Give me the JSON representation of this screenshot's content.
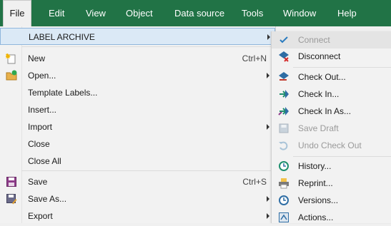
{
  "menubar": {
    "items": [
      {
        "label": "File"
      },
      {
        "label": "Edit"
      },
      {
        "label": "View"
      },
      {
        "label": "Object"
      },
      {
        "label": "Data source"
      },
      {
        "label": "Tools"
      },
      {
        "label": "Window"
      },
      {
        "label": "Help"
      }
    ]
  },
  "file_menu": {
    "label_archive": "LABEL ARCHIVE",
    "new": {
      "label": "New",
      "shortcut": "Ctrl+N"
    },
    "open": "Open...",
    "template_labels": "Template Labels...",
    "insert": "Insert...",
    "import": "Import",
    "close": "Close",
    "close_all": "Close All",
    "save": {
      "label": "Save",
      "shortcut": "Ctrl+S"
    },
    "save_as": "Save As...",
    "export": "Export"
  },
  "archive_submenu": {
    "connect": "Connect",
    "disconnect": "Disconnect",
    "check_out": "Check Out...",
    "check_in": "Check In...",
    "check_in_as": "Check In As...",
    "save_draft": "Save Draft",
    "undo_check_out": "Undo Check Out",
    "history": "History...",
    "reprint": "Reprint...",
    "versions": "Versions...",
    "actions": "Actions..."
  },
  "colors": {
    "menubar": "#217346",
    "highlight": "#dbe9f6",
    "accent": "#2a7bbf"
  }
}
